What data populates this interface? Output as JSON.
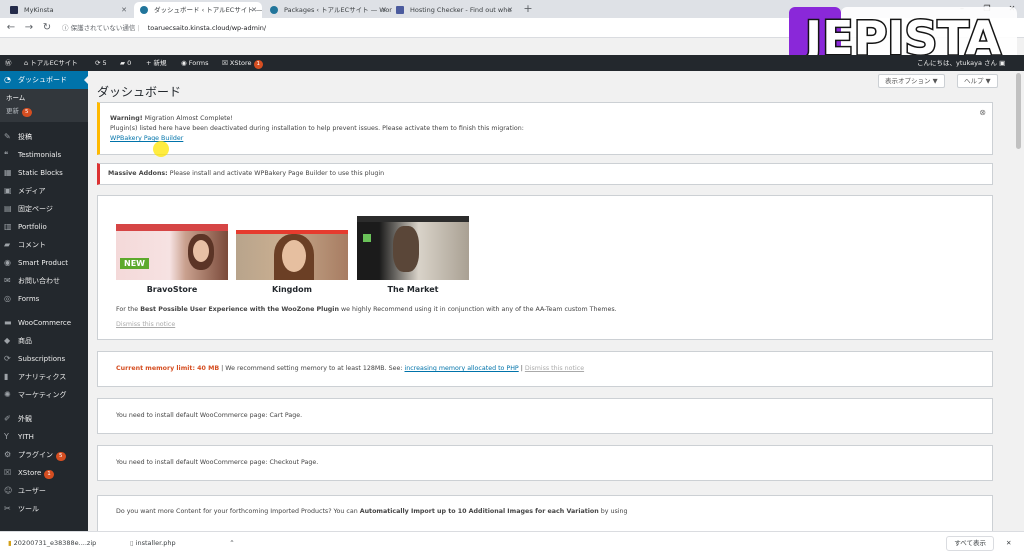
{
  "browser": {
    "tabs": [
      {
        "title": "MyKinsta",
        "active": false
      },
      {
        "title": "ダッシュボード ‹ トアルECサイト — W",
        "active": true
      },
      {
        "title": "Packages ‹ トアルECサイト — Word",
        "active": false
      },
      {
        "title": "Hosting Checker - Find out who",
        "active": false
      }
    ],
    "security_label": "保護されていない通信",
    "url": "toaruecsaito.kinsta.cloud/wp-admin/"
  },
  "watermark": "JEPISTA",
  "adminbar": {
    "site_name": "トアルECサイト",
    "updates_count": "5",
    "comments_count": "0",
    "new_label": "新規",
    "forms_label": "Forms",
    "xstore_label": "XStore",
    "xstore_badge": "1",
    "greeting": "こんにちは、ytukaya さん"
  },
  "sidebar": {
    "dashboard": "ダッシュボード",
    "home": "ホーム",
    "updates": "更新",
    "updates_badge": "5",
    "items": [
      {
        "label": "投稿",
        "icon": "pin-icon"
      },
      {
        "label": "Testimonials",
        "icon": "testimonial-icon"
      },
      {
        "label": "Static Blocks",
        "icon": "blocks-icon"
      },
      {
        "label": "メディア",
        "icon": "media-icon"
      },
      {
        "label": "固定ページ",
        "icon": "page-icon"
      },
      {
        "label": "Portfolio",
        "icon": "portfolio-icon"
      },
      {
        "label": "コメント",
        "icon": "comment-icon"
      },
      {
        "label": "Smart Product",
        "icon": "eye-icon"
      },
      {
        "label": "お問い合わせ",
        "icon": "mail-icon"
      },
      {
        "label": "Forms",
        "icon": "forms-icon"
      }
    ],
    "items2": [
      {
        "label": "WooCommerce",
        "icon": "woo-icon"
      },
      {
        "label": "商品",
        "icon": "product-icon"
      },
      {
        "label": "Subscriptions",
        "icon": "subscriptions-icon"
      },
      {
        "label": "アナリティクス",
        "icon": "analytics-icon"
      },
      {
        "label": "マーケティング",
        "icon": "marketing-icon"
      }
    ],
    "items3": [
      {
        "label": "外観",
        "icon": "appearance-icon",
        "badge": ""
      },
      {
        "label": "YITH",
        "icon": "yith-icon",
        "badge": ""
      },
      {
        "label": "プラグイン",
        "icon": "plugin-icon",
        "badge": "5"
      },
      {
        "label": "XStore",
        "icon": "xstore-icon",
        "badge": "1"
      },
      {
        "label": "ユーザー",
        "icon": "user-icon",
        "badge": ""
      },
      {
        "label": "ツール",
        "icon": "tools-icon",
        "badge": ""
      }
    ]
  },
  "main": {
    "screen_options": "表示オプション ▼",
    "help": "ヘルプ ▼",
    "page_title": "ダッシュボード",
    "migration": {
      "warning": "Warning!",
      "title_rest": " Migration Almost Complete!",
      "body": "Plugin(s) listed here have been deactivated during installation to help prevent issues. Please activate them to finish this migration:",
      "link": "WPBakery Page Builder"
    },
    "massive": {
      "bold": "Massive Addons:",
      "text": " Please install and activate WPBakery Page Builder to use this plugin"
    },
    "themes": [
      {
        "name": "BravoStore",
        "badge": "NEW"
      },
      {
        "name": "Kingdom",
        "badge": ""
      },
      {
        "name": "The Market",
        "badge": ""
      }
    ],
    "woozone": {
      "pre": "For the ",
      "bold": "Best Possible User Experience with the WooZone Plugin",
      "post": " we highly Recommend using it in conjunction with any of the AA-Team custom Themes.",
      "dismiss": "Dismiss this notice"
    },
    "memory": {
      "label": "Current memory limit: 40 MB",
      "text": " | We recommend setting memory to at least 128MB. See: ",
      "link": "increasing memory allocated to PHP",
      "sep": " | ",
      "dismiss": "Dismiss this notice"
    },
    "cart": "You need to install default WooCommerce page: Cart Page.",
    "checkout": "You need to install default WooCommerce page: Checkout Page.",
    "import": {
      "pre": "Do you want more Content for your forthcoming Imported Products? You can ",
      "bold": "Automatically Import up to 10 Additional Images for each Variation",
      "post": " by using"
    }
  },
  "downloads": {
    "files": [
      "20200731_e38388e....zip",
      "installer.php"
    ],
    "show_all": "すべて表示"
  }
}
